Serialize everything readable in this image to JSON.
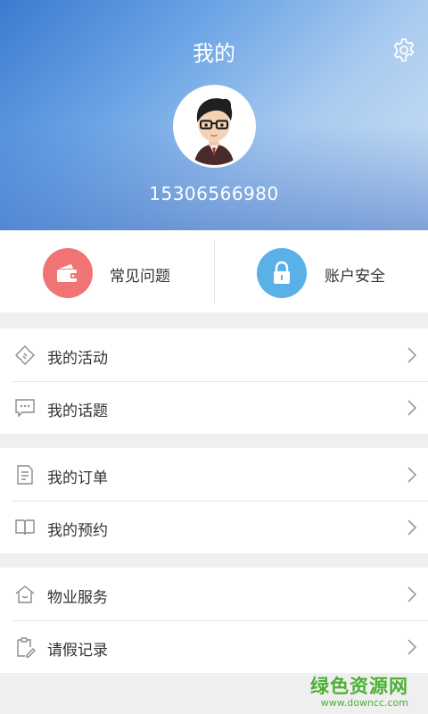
{
  "header": {
    "title": "我的",
    "settings_icon": "gear-icon",
    "phone": "15306566980"
  },
  "quick_actions": [
    {
      "label": "常见问题",
      "icon": "wallet-icon",
      "color": "#f07474"
    },
    {
      "label": "账户安全",
      "icon": "lock-icon",
      "color": "#5ab1e8"
    }
  ],
  "menu": {
    "group1": [
      {
        "label": "我的活动",
        "icon": "ticket-icon"
      },
      {
        "label": "我的话题",
        "icon": "chat-bubble-icon"
      }
    ],
    "group2": [
      {
        "label": "我的订单",
        "icon": "document-icon"
      },
      {
        "label": "我的预约",
        "icon": "book-icon"
      }
    ],
    "group3": [
      {
        "label": "物业服务",
        "icon": "house-icon"
      },
      {
        "label": "请假记录",
        "icon": "clipboard-pen-icon"
      }
    ]
  },
  "watermark": {
    "main": "绿色资源网",
    "sub": "www.downcc.com"
  }
}
